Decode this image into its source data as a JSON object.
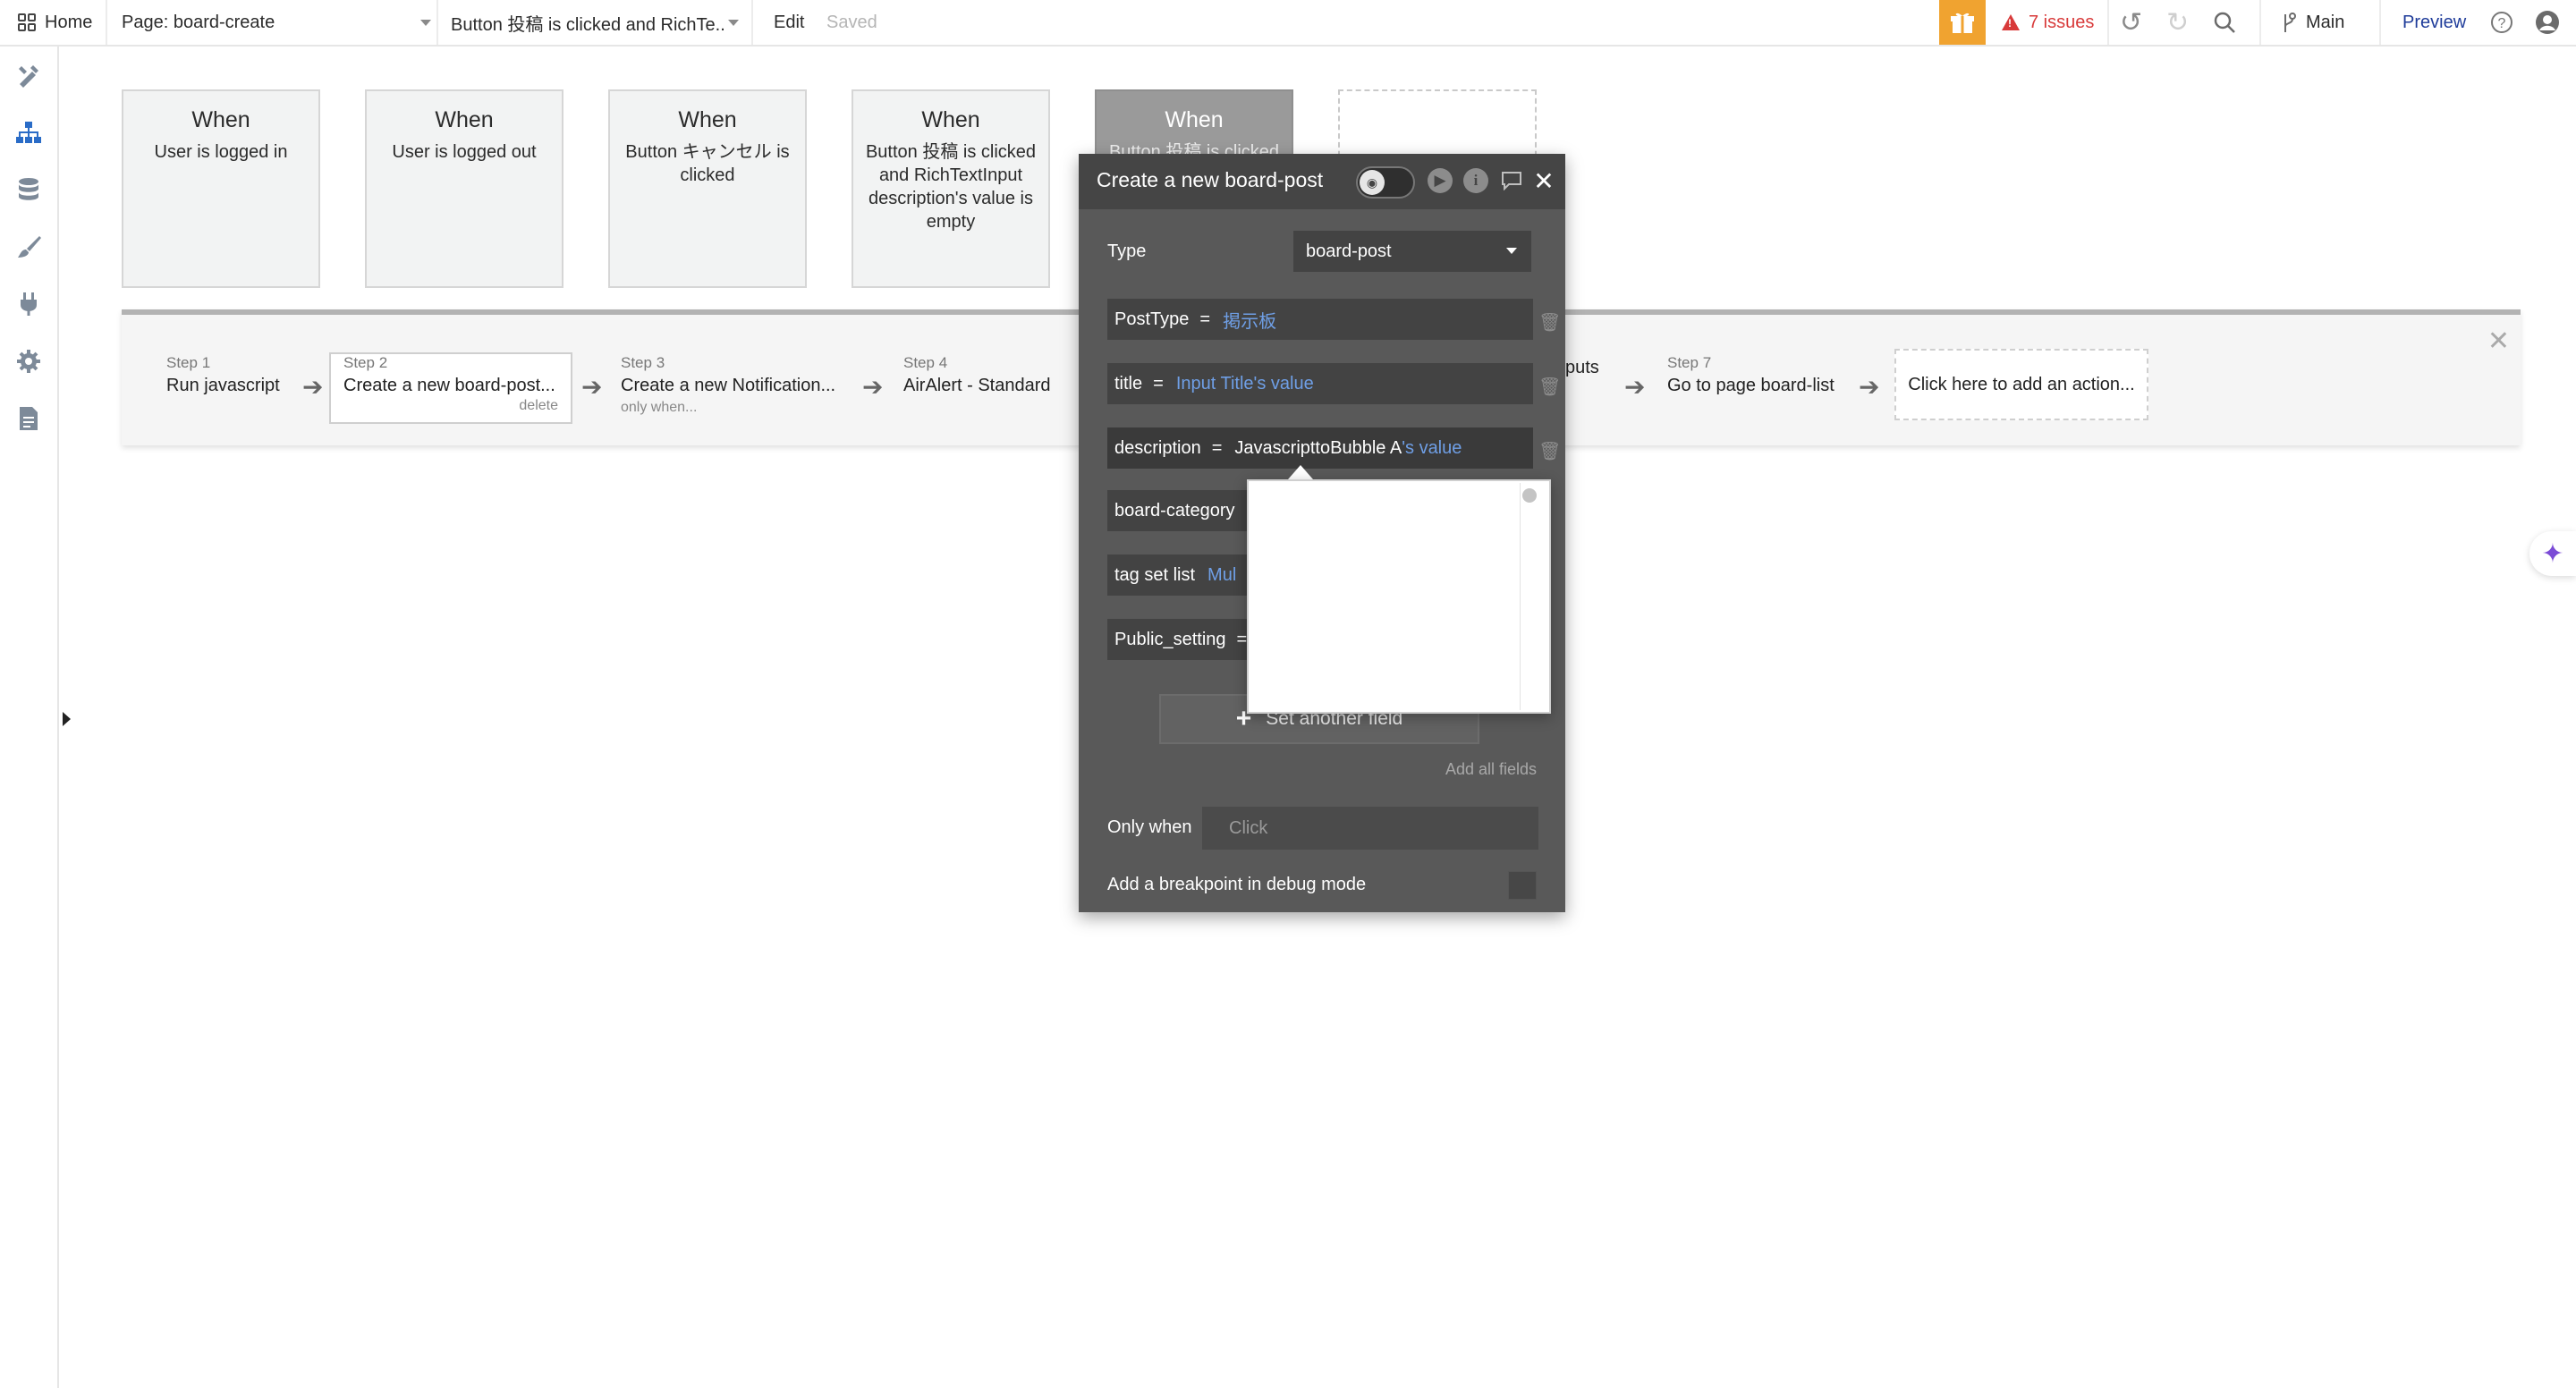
{
  "topbar": {
    "home_label": "Home",
    "page_selector": "Page: board-create",
    "workflow_selector": "Button 投稿 is clicked and RichTe...",
    "edit_label": "Edit",
    "saved_label": "Saved",
    "issues_label": "7 issues",
    "branch_label": "Main",
    "preview_label": "Preview",
    "accent_color": "#f0a330",
    "issues_color": "#d83a3a",
    "preview_color": "#1f3c9a"
  },
  "sidebar": {
    "items": [
      {
        "icon": "design-icon"
      },
      {
        "icon": "workflow-icon",
        "active": true
      },
      {
        "icon": "data-icon"
      },
      {
        "icon": "styles-icon"
      },
      {
        "icon": "plugins-icon"
      },
      {
        "icon": "settings-icon"
      },
      {
        "icon": "logs-icon"
      }
    ]
  },
  "events": [
    {
      "when": "When",
      "desc": "User is logged in"
    },
    {
      "when": "When",
      "desc": "User is logged out"
    },
    {
      "when": "When",
      "desc": "Button キャンセル is clicked"
    },
    {
      "when": "When",
      "desc": "Button 投稿 is clicked and RichTextInput description's value is empty"
    },
    {
      "when": "When",
      "desc": "Button 投稿 is clicked"
    }
  ],
  "actions": {
    "steps": [
      {
        "label": "Step 1",
        "name": "Run javascript"
      },
      {
        "label": "Step 2",
        "name": "Create a new board-post...",
        "sub": "delete"
      },
      {
        "label": "Step 3",
        "name": "Create a new Notification...",
        "sub": "only when..."
      },
      {
        "label": "Step 4",
        "name": "AirAlert - Standard"
      },
      {
        "label": "",
        "name": "puts"
      },
      {
        "label": "Step 7",
        "name": "Go to page board-list"
      }
    ],
    "add_action": "Click here to add an action..."
  },
  "editor": {
    "title": "Create a new board-post",
    "type_label": "Type",
    "type_value": "board-post",
    "fields": [
      {
        "name": "PostType",
        "eq": "=",
        "value": "掲示板",
        "value2": ""
      },
      {
        "name": "title",
        "eq": "=",
        "value": "Input Title's value",
        "value2": ""
      },
      {
        "name": "description",
        "eq": "=",
        "value": "JavascripttoBubble A",
        "value2": "'s value"
      },
      {
        "name": "board-category",
        "eq": "",
        "value": "",
        "value2": ""
      },
      {
        "name": "tag set list",
        "eq": "",
        "value": "Mul",
        "value2": ""
      },
      {
        "name": "Public_setting",
        "eq": "=",
        "value": "",
        "value2": ""
      }
    ],
    "set_another_field": "Set another field",
    "add_all_fields": "Add all fields",
    "only_when_label": "Only when",
    "only_when_placeholder": "Click",
    "breakpoint_label": "Add a breakpoint in debug mode"
  }
}
